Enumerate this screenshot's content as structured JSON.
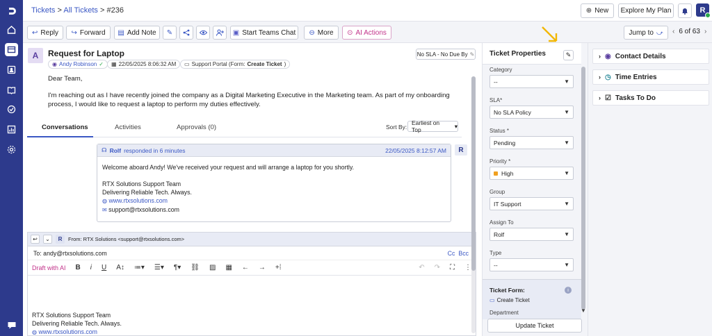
{
  "nav": {
    "logo_icon": "logo-icon",
    "items": [
      "home-icon",
      "tickets-icon",
      "contacts-icon",
      "knowledge-icon",
      "tasks-icon",
      "reports-icon",
      "settings-icon"
    ],
    "chat_icon": "chat-icon"
  },
  "header": {
    "breadcrumb_tickets": "Tickets",
    "breadcrumb_all": "All Tickets",
    "breadcrumb_id": "#236",
    "sep": ">",
    "new_label": "New",
    "explore_label": "Explore My Plan",
    "user_initial": "R"
  },
  "toolbar": {
    "reply": "Reply",
    "forward": "Forward",
    "add_note": "Add Note",
    "teams": "Start Teams Chat",
    "more": "More",
    "ai_actions": "AI Actions",
    "jump_to": "Jump to",
    "pager": "6 of 63"
  },
  "ticket": {
    "avatar_initial": "A",
    "subject": "Request for Laptop",
    "sla": "No SLA - No Due By",
    "requester": "Andy Robinson",
    "datetime": "22/05/2025 8:06:32 AM",
    "source_prefix": "Support Portal (Form:",
    "source_form": "Create Ticket",
    "source_suffix": ")",
    "greeting": "Dear Team,",
    "body": "I'm reaching out as I have recently joined the company as a Digital Marketing Executive in the Marketing team. As part of my onboarding process, I would like to request a laptop to perform my duties effectively."
  },
  "tabs": {
    "conversations": "Conversations",
    "activities": "Activities",
    "approvals": "Approvals (0)",
    "sort_label": "Sort By:",
    "sort_value": "Earliest on Top"
  },
  "conversation": {
    "author": "Rolf",
    "response": "responded in 6 minutes",
    "timestamp": "22/05/2025 8:12:57 AM",
    "message": "Welcome aboard Andy! We've received your request and will arrange a laptop for you shortly.",
    "sig_team": "RTX Solutions Support Team",
    "sig_tagline": "Delivering Reliable Tech. Always.",
    "sig_web": "www.rtxsolutions.com",
    "sig_email": "support@rtxsolutions.com",
    "avatar_initial": "R"
  },
  "editor": {
    "from_badge": "R",
    "from": "From:  RTX Solutions <support@rtxsolutions.com>",
    "to": "To: andy@rtxsolutions.com",
    "cc": "Cc",
    "bcc": "Bcc",
    "draft_ai": "Draft with AI",
    "sig_team": "RTX Solutions Support Team",
    "sig_tagline": "Delivering Reliable Tech. Always.",
    "sig_web": "www.rtxsolutions.com"
  },
  "properties": {
    "title": "Ticket Properties",
    "category_label": "Category",
    "category_value": "--",
    "sla_label": "SLA*",
    "sla_value": "No SLA Policy",
    "status_label": "Status *",
    "status_value": "Pending",
    "priority_label": "Priority *",
    "priority_value": "High",
    "priority_color": "#f0a020",
    "group_label": "Group",
    "group_value": "IT Support",
    "assign_label": "Assign To",
    "assign_value": "Rolf",
    "type_label": "Type",
    "type_value": "--",
    "form_label": "Ticket Form:",
    "form_value": "Create Ticket",
    "department_label": "Department",
    "update_button": "Update Ticket"
  },
  "side": {
    "contact_details": "Contact Details",
    "time_entries": "Time Entries",
    "tasks": "Tasks To Do"
  },
  "colors": {
    "nav": "#2d3a8c",
    "accent": "#3a57c4",
    "ai": "#c2338a",
    "arrow": "#f2b705"
  }
}
